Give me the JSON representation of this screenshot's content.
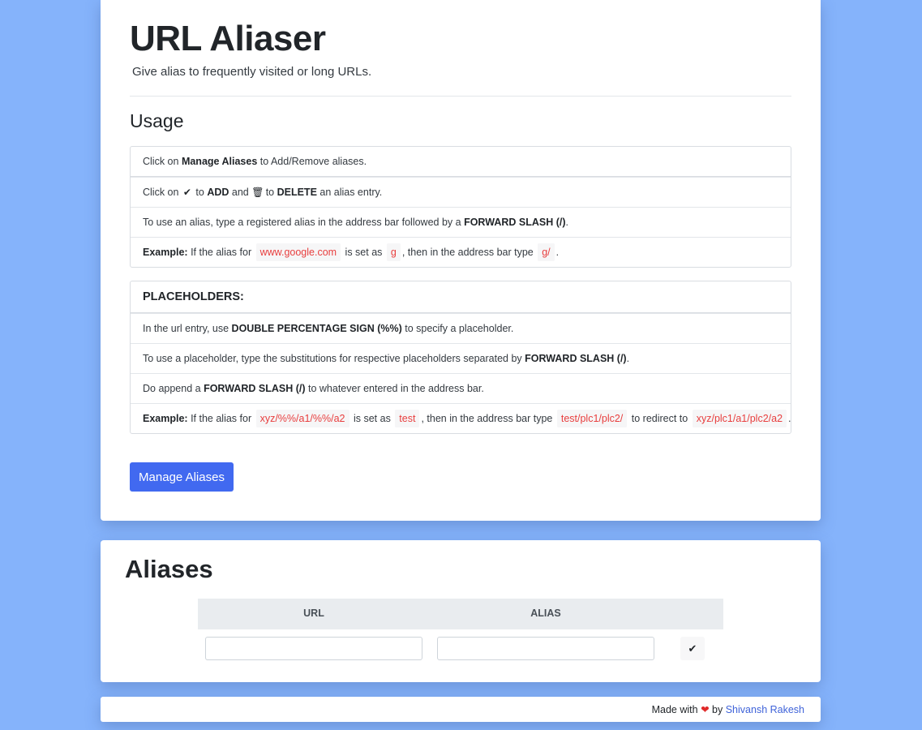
{
  "header": {
    "title": "URL Aliaser",
    "subtitle": "Give alias to frequently visited or long URLs."
  },
  "usage": {
    "heading": "Usage",
    "item1": {
      "pre": "Click on ",
      "bold": "Manage Aliases",
      "post": " to Add/Remove aliases."
    },
    "item2": {
      "pre": "Click on ",
      "check_icon": "✔",
      "mid1": " to ",
      "add": "ADD",
      "mid2": " and ",
      "trash_icon": "🗑",
      "mid3": " to ",
      "delete": "DELETE",
      "post": " an alias entry."
    },
    "item3": {
      "pre": "To use an alias, type a registered alias in the address bar followed by a ",
      "bold": "FORWARD SLASH (/)",
      "post": "."
    },
    "item4": {
      "label": "Example:",
      "t1": " If the alias for ",
      "c1": "www.google.com",
      "t2": " is set as ",
      "c2": "g",
      "t3": ", then in the address bar type ",
      "c3": "g/",
      "t4": "."
    }
  },
  "placeholders": {
    "heading": "PLACEHOLDERS:",
    "item1": {
      "pre": "In the url entry, use ",
      "bold": "DOUBLE PERCENTAGE SIGN (%%)",
      "post": " to specify a placeholder."
    },
    "item2": {
      "pre": "To use a placeholder, type the substitutions for respective placeholders separated by ",
      "bold": "FORWARD SLASH (/)",
      "post": "."
    },
    "item3": {
      "pre": "Do append a ",
      "bold": "FORWARD SLASH (/)",
      "post": " to whatever entered in the address bar."
    },
    "item4": {
      "label": "Example:",
      "t1": " If the alias for ",
      "c1": "xyz/%%/a1/%%/a2",
      "t2": " is set as ",
      "c2": "test",
      "t3": ", then in the address bar type ",
      "c3": "test/plc1/plc2/",
      "t4": " to redirect to ",
      "c4": "xyz/plc1/a1/plc2/a2",
      "t5": "."
    }
  },
  "manage_button": "Manage Aliases",
  "aliases": {
    "title": "Aliases",
    "columns": [
      "URL",
      "ALIAS"
    ],
    "url_value": "",
    "alias_value": "",
    "add_icon": "✔"
  },
  "footer": {
    "made_with": "Made with",
    "heart_icon": "❤",
    "by": "by",
    "author": "Shivansh Rakesh"
  },
  "colors": {
    "background": "#85b3fb",
    "primary_button": "#4169f0",
    "code_text": "#e83e3e",
    "link": "#3f63d9",
    "heart": "#e02a2a"
  }
}
